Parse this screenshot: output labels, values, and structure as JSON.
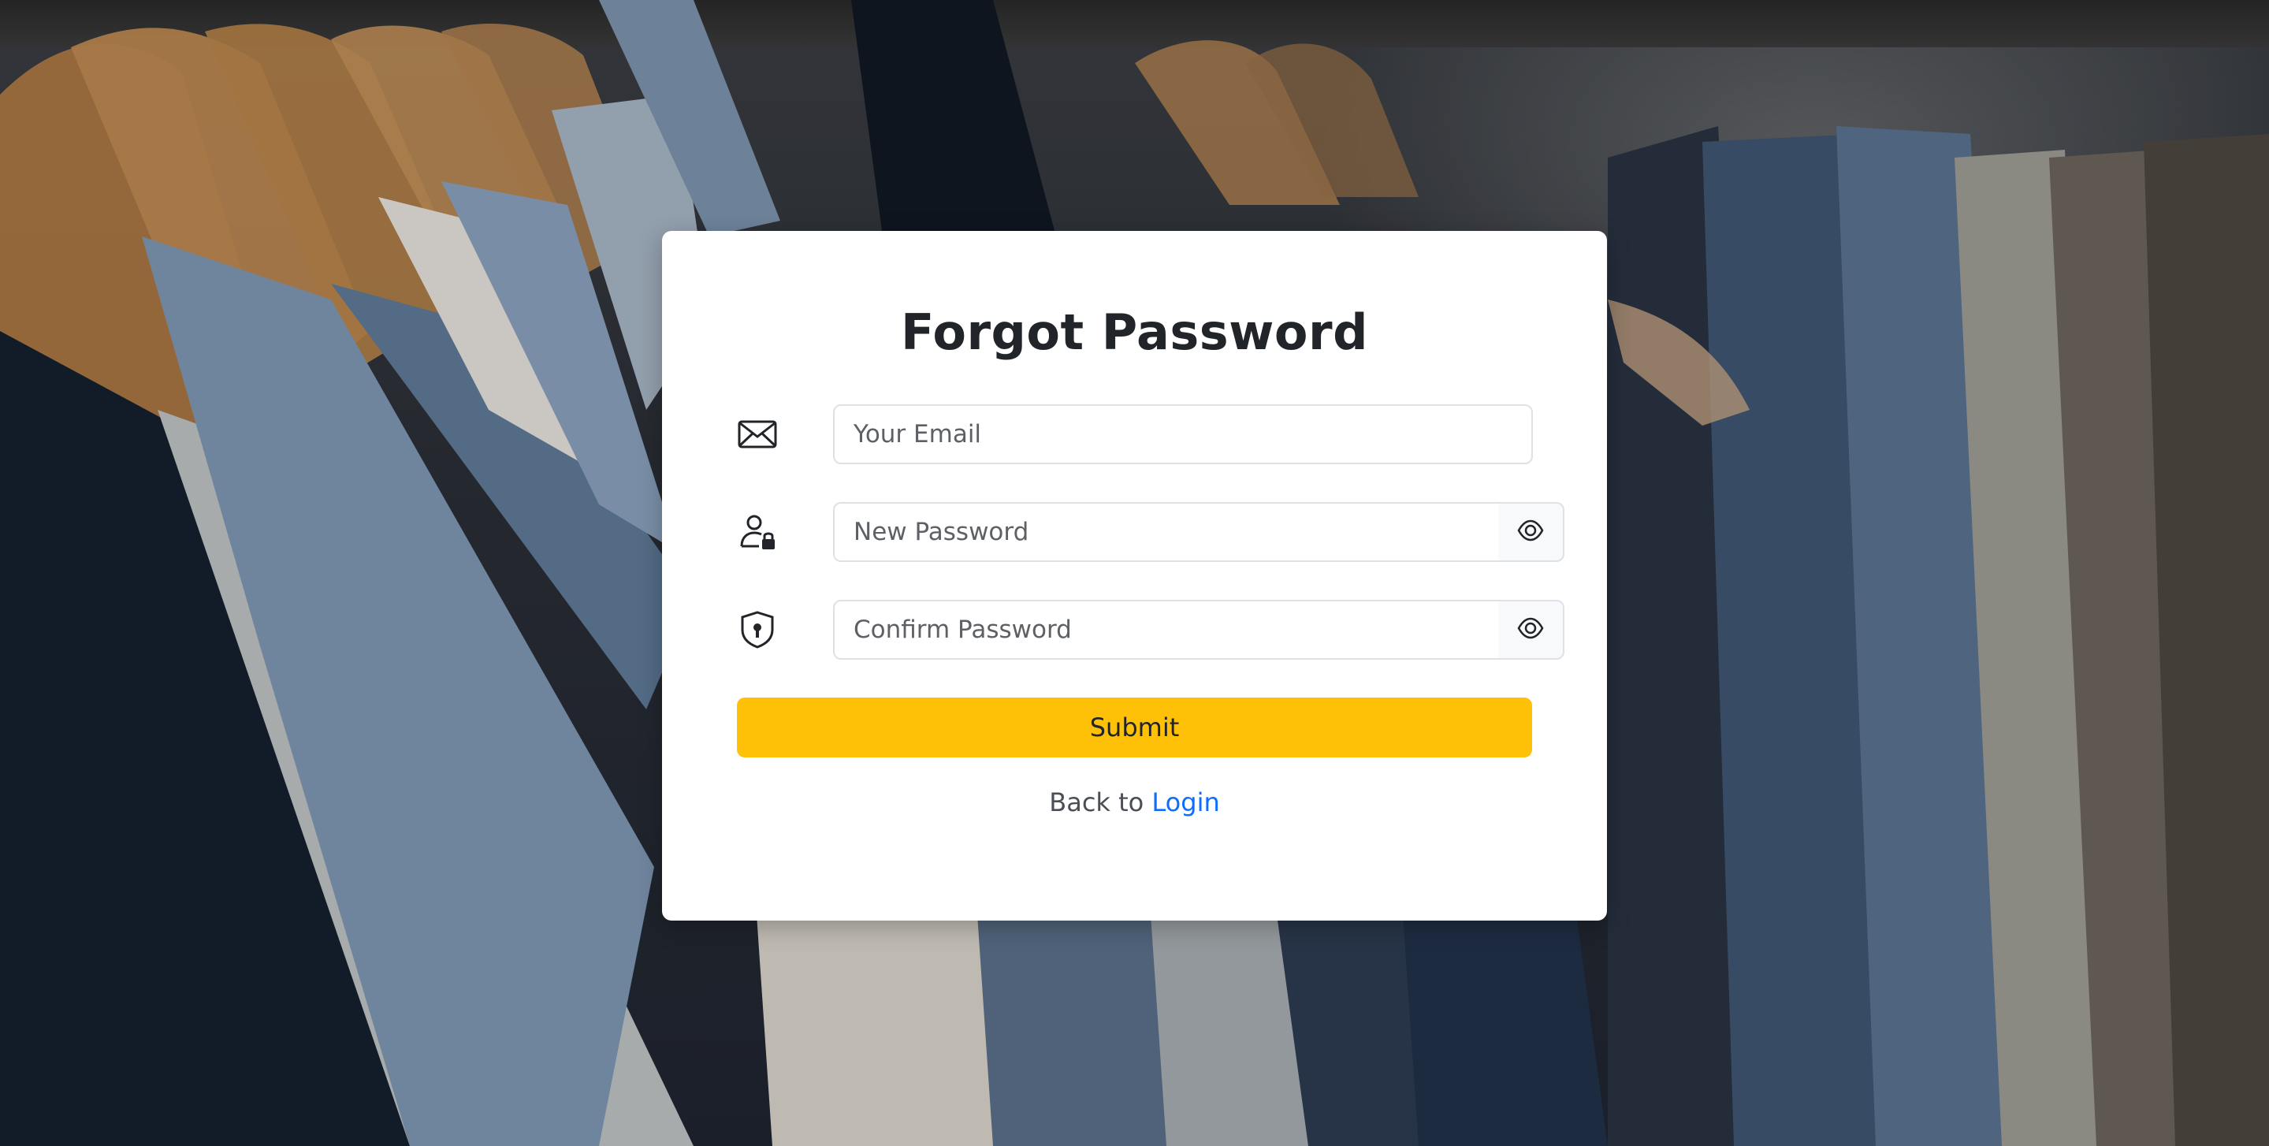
{
  "page": {
    "title": "Forgot Password"
  },
  "form": {
    "email": {
      "placeholder": "Your Email",
      "value": "",
      "icon": "envelope-icon"
    },
    "new_password": {
      "placeholder": "New Password",
      "value": "",
      "icon": "person-lock-icon",
      "toggle_icon": "eye-icon"
    },
    "confirm_password": {
      "placeholder": "Confirm Password",
      "value": "",
      "icon": "shield-lock-icon",
      "toggle_icon": "eye-icon"
    },
    "submit_label": "Submit"
  },
  "footer": {
    "back_prefix": "Back to",
    "login_link": "Login"
  },
  "colors": {
    "accent_button": "#ffc107",
    "link": "#0d6efd",
    "card": "#ffffff"
  },
  "background": {
    "description_icon": "clothing-rack-photo"
  }
}
